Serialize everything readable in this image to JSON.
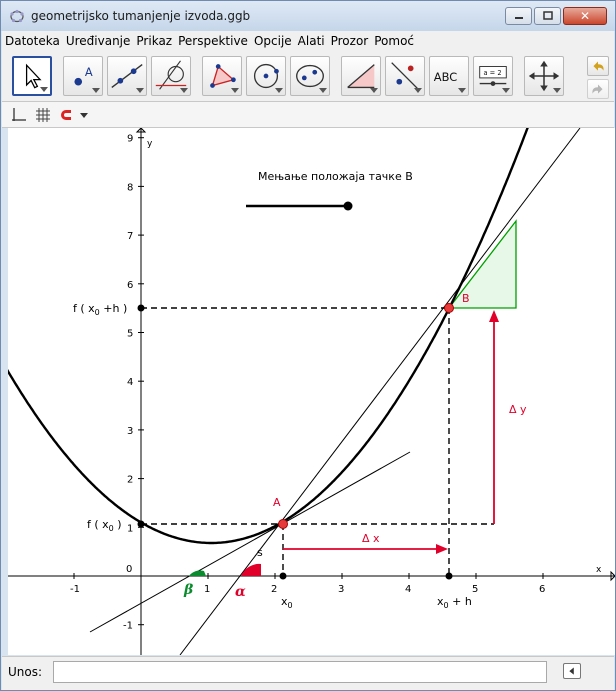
{
  "window": {
    "title": "geometrijsko tumanjenje izvoda.ggb"
  },
  "menu": [
    "Datoteka",
    "Uređivanje",
    "Prikaz",
    "Perspektive",
    "Opcije",
    "Alati",
    "Prozor",
    "Pomoć"
  ],
  "toolbar": {
    "tools": [
      {
        "name": "move-tool",
        "icon": "arrow-cursor-icon"
      },
      {
        "name": "point-tool",
        "icon": "point-icon"
      },
      {
        "name": "line-tool",
        "icon": "line-through-points-icon"
      },
      {
        "name": "perpendicular-tool",
        "icon": "perpendicular-icon"
      },
      {
        "name": "polygon-tool",
        "icon": "polygon-icon"
      },
      {
        "name": "circle-tool",
        "icon": "circle-center-point-icon"
      },
      {
        "name": "conic-tool",
        "icon": "ellipse-icon"
      },
      {
        "name": "angle-tool",
        "icon": "angle-icon"
      },
      {
        "name": "reflect-tool",
        "icon": "reflect-icon"
      },
      {
        "name": "text-tool",
        "icon": "text-icon",
        "label": "ABC"
      },
      {
        "name": "slider-tool",
        "icon": "slider-icon",
        "label": "a = 2"
      },
      {
        "name": "move-view-tool",
        "icon": "move-graphics-view-icon"
      }
    ]
  },
  "graph": {
    "slider_label": "Мењање положаја тачке B",
    "x_axis_label": "x",
    "y_axis_label": "y",
    "x_ticks": [
      "-1",
      "0",
      "1",
      "2",
      "3",
      "4",
      "5",
      "6"
    ],
    "y_ticks": [
      "-1",
      "1",
      "2",
      "3",
      "4",
      "5",
      "6",
      "7",
      "8",
      "9"
    ],
    "origin_label": "0",
    "point_a_label": "A",
    "point_b_label": "B",
    "line_s_label": "s",
    "angle_alpha_label": "α",
    "angle_beta_label": "β",
    "delta_x_label": "Δ x",
    "delta_y_label": "Δ y",
    "fx0_label": "f ( x",
    "fx0_sub": "0",
    "fx0_close": " )",
    "fx0h_label": "f ( x",
    "fx0h_sub": "0",
    "fx0h_close": " +h )",
    "x0_label": "x",
    "x0_sub": "0",
    "x0h_label": "x",
    "x0h_sub": "0",
    "x0h_rest": " + h",
    "colors": {
      "curve": "#000000",
      "secant": "#000000",
      "red": "#e0002a",
      "green": "#00a000",
      "point": "#e53b3b"
    }
  },
  "chart_data": {
    "type": "line",
    "function": "f(x) = 0.5x² − 0.8x + 1.1 (approx.)",
    "points": {
      "A": {
        "x": 2.1,
        "y": 1.1
      },
      "B": {
        "x": 4.6,
        "y": 5.5
      }
    },
    "xlim": [
      -2.0,
      7.0
    ],
    "ylim": [
      -1.7,
      9.2
    ]
  },
  "input_bar": {
    "label": "Unos:",
    "value": ""
  }
}
